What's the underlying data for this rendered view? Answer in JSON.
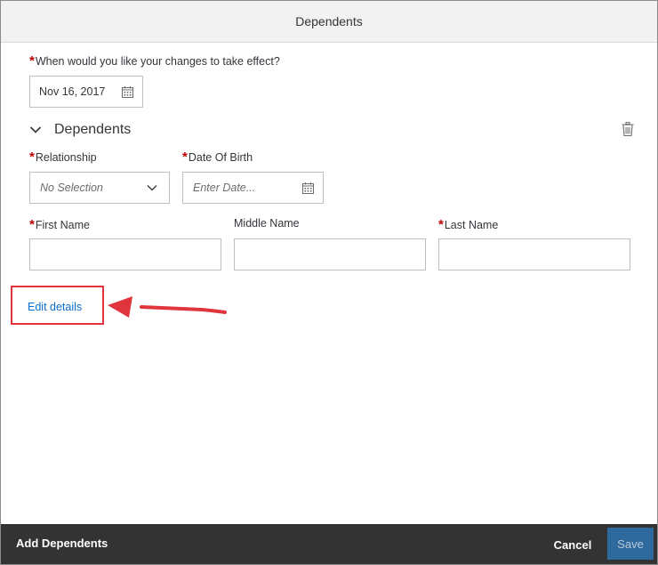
{
  "dialog": {
    "title": "Dependents",
    "effective": {
      "label": "When would you like your changes to take effect?",
      "value": "Nov 16, 2017"
    },
    "section": {
      "title": "Dependents"
    },
    "fields": {
      "relationship": {
        "label": "Relationship",
        "placeholder": "No Selection"
      },
      "dob": {
        "label": "Date Of Birth",
        "placeholder": "Enter Date..."
      },
      "first_name": {
        "label": "First Name",
        "value": ""
      },
      "middle_name": {
        "label": "Middle Name",
        "value": ""
      },
      "last_name": {
        "label": "Last Name",
        "value": ""
      }
    },
    "edit_link": "Edit details",
    "required_mark": "*"
  },
  "footer": {
    "title": "Add Dependents",
    "cancel_label": "Cancel",
    "save_label": "Save"
  },
  "colors": {
    "accent_link": "#0a6ed1",
    "required": "#bb0000",
    "annotation": "#e0353c",
    "footer_bg": "#333333",
    "save_bg": "#2e6a9e"
  },
  "icons": [
    "calendar-icon",
    "chevron-down-icon",
    "trash-icon",
    "dropdown-icon",
    "arrow-annotation"
  ]
}
